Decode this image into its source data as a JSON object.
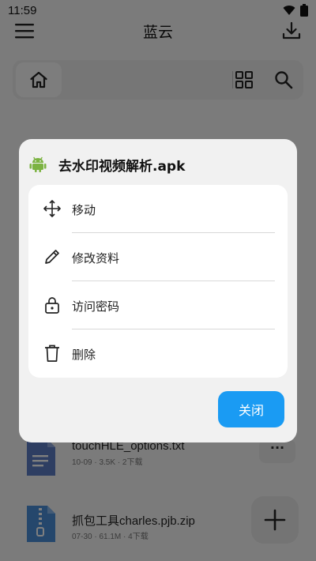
{
  "status_bar": {
    "time": "11:59"
  },
  "app_bar": {
    "title": "蓝云"
  },
  "files": [
    {
      "name": "touchHLE_options.txt",
      "meta": "10-09 · 3.5K · 2下载",
      "more": "···"
    },
    {
      "name": "抓包工具charles.pjb.zip",
      "meta": "07-30 · 61.1M · 4下载"
    }
  ],
  "dialog": {
    "title": "去水印视频解析.apk",
    "actions": [
      {
        "label": "移动",
        "icon": "move-icon"
      },
      {
        "label": "修改资料",
        "icon": "pencil-icon"
      },
      {
        "label": "访问密码",
        "icon": "lock-icon"
      },
      {
        "label": "删除",
        "icon": "trash-icon"
      }
    ],
    "close_label": "关闭"
  },
  "colors": {
    "accent": "#1a9bf3",
    "android_green": "#7cb342",
    "txt_file": "#5c7cc4",
    "zip_file": "#4a8fd8"
  }
}
